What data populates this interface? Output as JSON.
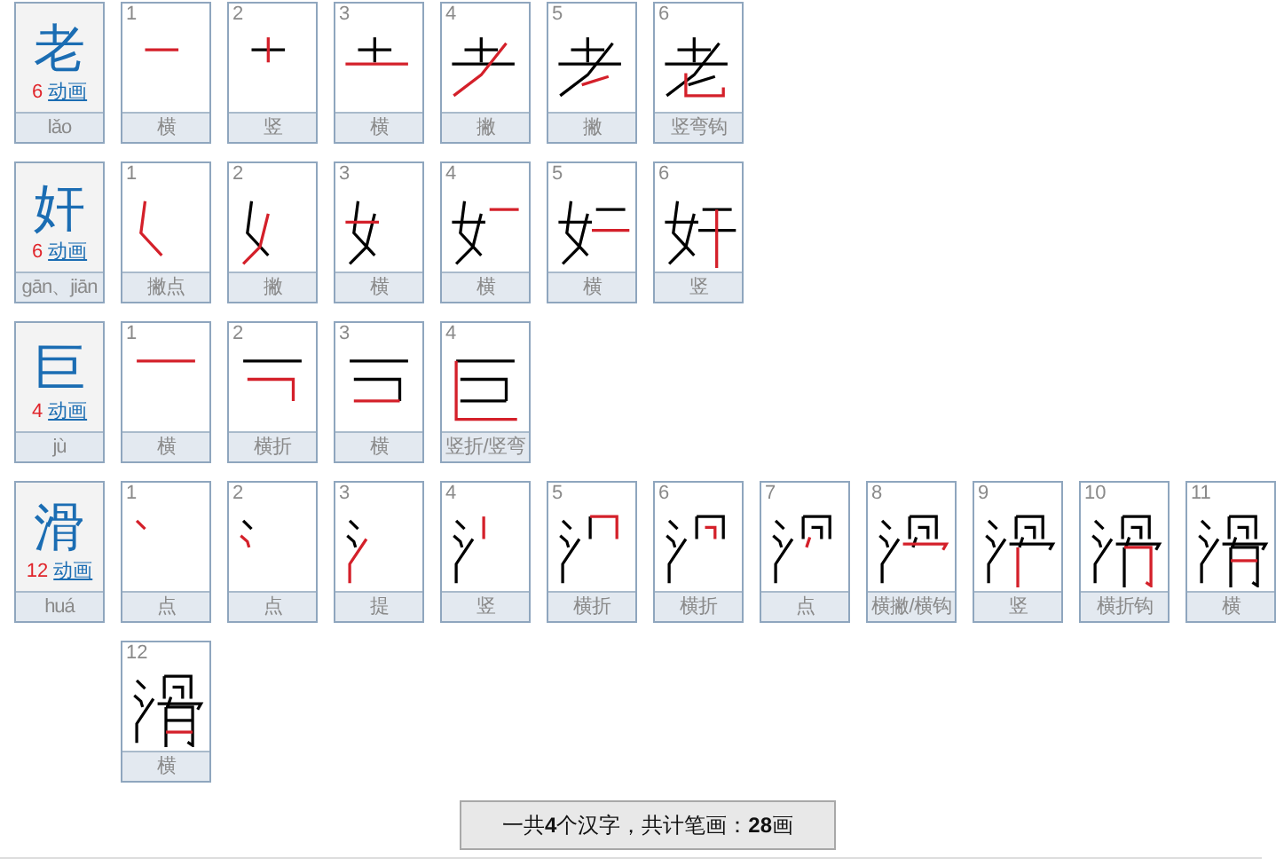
{
  "characters": [
    {
      "char": "老",
      "stroke_count": "6",
      "animation_link": "动画",
      "pinyin": "lǎo",
      "strokes": [
        {
          "number": "1",
          "name": "横"
        },
        {
          "number": "2",
          "name": "竖"
        },
        {
          "number": "3",
          "name": "横"
        },
        {
          "number": "4",
          "name": "撇"
        },
        {
          "number": "5",
          "name": "撇"
        },
        {
          "number": "6",
          "name": "竖弯钩"
        }
      ]
    },
    {
      "char": "奸",
      "stroke_count": "6",
      "animation_link": "动画",
      "pinyin": "gān、jiān",
      "strokes": [
        {
          "number": "1",
          "name": "撇点"
        },
        {
          "number": "2",
          "name": "撇"
        },
        {
          "number": "3",
          "name": "横"
        },
        {
          "number": "4",
          "name": "横"
        },
        {
          "number": "5",
          "name": "横"
        },
        {
          "number": "6",
          "name": "竖"
        }
      ]
    },
    {
      "char": "巨",
      "stroke_count": "4",
      "animation_link": "动画",
      "pinyin": "jù",
      "strokes": [
        {
          "number": "1",
          "name": "横"
        },
        {
          "number": "2",
          "name": "横折"
        },
        {
          "number": "3",
          "name": "横"
        },
        {
          "number": "4",
          "name": "竖折/竖弯"
        }
      ]
    },
    {
      "char": "滑",
      "stroke_count": "12",
      "animation_link": "动画",
      "pinyin": "huá",
      "strokes": [
        {
          "number": "1",
          "name": "点"
        },
        {
          "number": "2",
          "name": "点"
        },
        {
          "number": "3",
          "name": "提"
        },
        {
          "number": "4",
          "name": "竖"
        },
        {
          "number": "5",
          "name": "横折"
        },
        {
          "number": "6",
          "name": "横折"
        },
        {
          "number": "7",
          "name": "点"
        },
        {
          "number": "8",
          "name": "横撇/横钩"
        },
        {
          "number": "9",
          "name": "竖"
        },
        {
          "number": "10",
          "name": "横折钩"
        },
        {
          "number": "11",
          "name": "横"
        },
        {
          "number": "12",
          "name": "横"
        }
      ]
    }
  ],
  "summary": "一共**4**个汉字，共计笔画：**28**画"
}
